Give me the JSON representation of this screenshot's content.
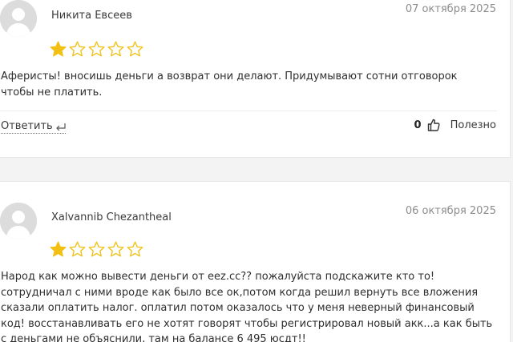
{
  "reviews": [
    {
      "author": "Никита Евсеев",
      "date": "07 октября 2025",
      "rating": 1,
      "max_rating": 5,
      "text": "Аферисты! вносишь деньги а возврат они делают. Придумывают сотни отговорок чтобы не платить.",
      "reply_label": "Ответить",
      "likes": "0",
      "helpful_label": "Полезно"
    },
    {
      "author": "Xalvannib Chezantheal",
      "date": "06 октября 2025",
      "rating": 1,
      "max_rating": 5,
      "text": "Народ как можно вывести деньги от eez.cc?? пожалуйста подскажите кто то! сотрудничал с ними вроде как было все ок,потом когда решил вернуть все вложения сказали оплатить налог. оплатил потом оказалось что у меня неверный финансовый код! восстанавливать его не хотят говорят чтобы регистрировал новый акк...а как быть с деньгами не объяснили, там на балансе 6 495 юсдт!!"
    }
  ],
  "colors": {
    "star_filled": "#f2c012",
    "star_empty_stroke": "#f2c012",
    "avatar_bg": "#dcdcdc",
    "avatar_fg": "#ffffff",
    "date_text": "#8c8c8c"
  },
  "icons": {
    "avatar": "user-silhouette-icon",
    "star": "star-icon",
    "reply": "reply-arrow-icon",
    "like": "thumbs-up-icon"
  }
}
